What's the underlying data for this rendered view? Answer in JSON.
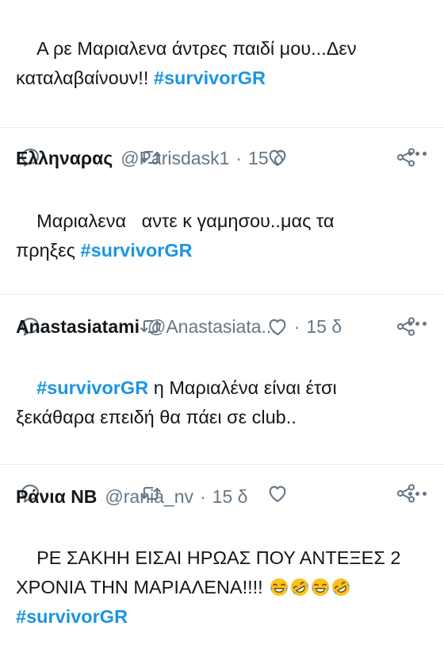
{
  "tweets": [
    {
      "name": "",
      "handle": "",
      "time": "",
      "text_line1": "Α ρε Μαριαλενα άντρες παιδί μου...Δεν",
      "text_line2_pre": "καταλαβαίνουν!! ",
      "hashtag": "#survivorGR"
    },
    {
      "name": "Ελληναρας",
      "handle": "@Parisdask1",
      "separator": "·",
      "time": "15 δ",
      "text_line1": "Μαριαλενα   αντε κ γαμησου..μας τα",
      "text_line2_pre": "πρηξες ",
      "hashtag": "#survivorGR"
    },
    {
      "name": "Anastasiatami",
      "handle": "@Anastasiata...",
      "separator": "·",
      "time": "15 δ",
      "hashtag": "#survivorGR",
      "text_line1_post": " η Μαριαλένα είναι έτσι",
      "text_line2": "ξεκάθαρα επειδή θα πάει σε club.."
    },
    {
      "name": "Ράνια ΝΒ",
      "handle": "@rania_nv",
      "separator": "·",
      "time": "15 δ",
      "text_line1": "ΡΕ ΣΑΚΗΗ ΕΙΣΑΙ ΗΡΩΑΣ ΠΟΥ ΑΝΤΕΞΕΣ 2",
      "text_line2": "ΧΡΟΝΙΑ ΤΗΝ ΜΑΡΙΑΛΕΝΑ!!!! ",
      "emojis": [
        "laughing-tears",
        "rolling-laughing",
        "laughing-tears",
        "rolling-laughing"
      ],
      "hashtag": "#survivorGR"
    }
  ],
  "colors": {
    "hashtag": "#1b95e0",
    "meta": "#657786",
    "text": "#14171a",
    "divider": "#e6ecf0"
  },
  "icons": [
    "reply-icon",
    "retweet-icon",
    "like-icon",
    "share-icon",
    "more-icon"
  ]
}
